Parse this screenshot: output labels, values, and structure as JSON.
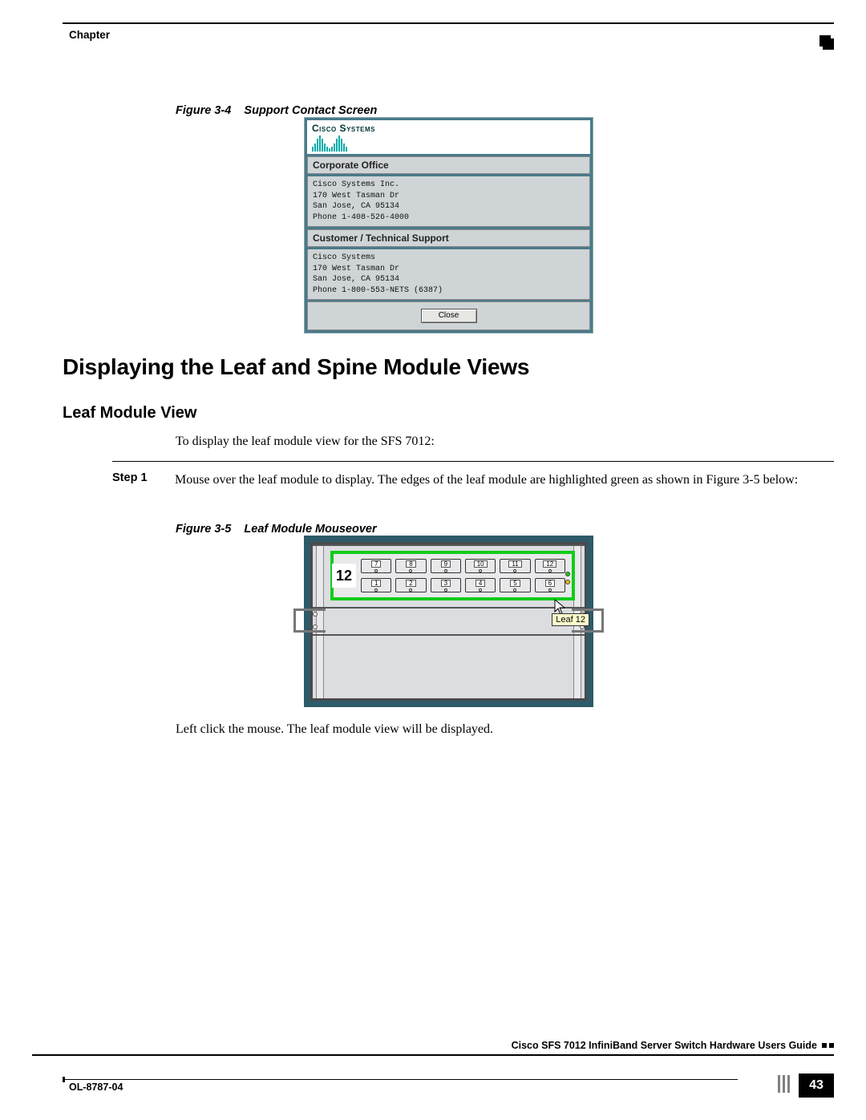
{
  "header": {
    "chapter_label": "Chapter"
  },
  "figures": {
    "f1": {
      "caption_prefix": "Figure 3-4",
      "caption_title": "Support Contact Screen"
    },
    "f2": {
      "caption_prefix": "Figure 3-5",
      "caption_title": "Leaf Module Mouseover"
    }
  },
  "support_screen": {
    "logo_text": "Cisco Systems",
    "section1_header": "Corporate Office",
    "section1_body": "Cisco Systems Inc.\n170 West Tasman Dr\nSan Jose, CA 95134\nPhone 1-408-526-4000",
    "section2_header": "Customer / Technical Support",
    "section2_body": "Cisco Systems\n170 West Tasman Dr\nSan Jose, CA 95134\nPhone 1-800-553-NETS (6387)",
    "close_label": "Close"
  },
  "headings": {
    "h1": "Displaying the Leaf and Spine Module Views",
    "h2": "Leaf Module View"
  },
  "body": {
    "intro": "To display the leaf module view for the SFS 7012:",
    "step1_label": "Step 1",
    "step1_text": "Mouse over the leaf module to display. The edges of the leaf module are highlighted green as shown in Figure 3-5 below:",
    "after_fig": "Left click the mouse. The leaf module view will be displayed."
  },
  "module": {
    "number": "12",
    "tooltip": "Leaf 12",
    "ports_top": [
      "7",
      "8",
      "9",
      "10",
      "11",
      "12"
    ],
    "ports_bottom": [
      "1",
      "2",
      "3",
      "4",
      "5",
      "6"
    ]
  },
  "footer": {
    "guide_title": "Cisco SFS 7012 InfiniBand Server Switch Hardware Users Guide",
    "doc_id": "OL-8787-04",
    "page": "43"
  }
}
